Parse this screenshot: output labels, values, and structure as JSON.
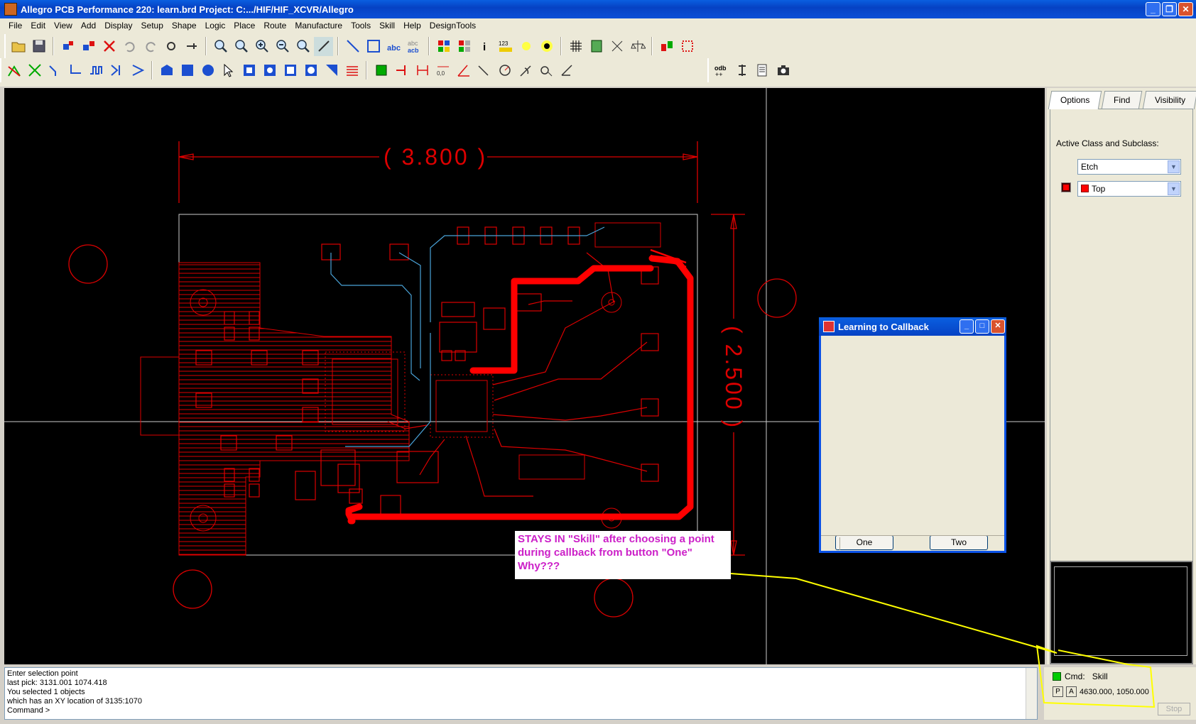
{
  "window": {
    "title": "Allegro PCB Performance 220: learn.brd  Project: C:.../HIF/HIF_XCVR/Allegro",
    "minimize": "_",
    "restore": "❐",
    "close": "✕"
  },
  "menu": [
    "File",
    "Edit",
    "View",
    "Add",
    "Display",
    "Setup",
    "Shape",
    "Logic",
    "Place",
    "Route",
    "Manufacture",
    "Tools",
    "Skill",
    "Help",
    "DesignTools"
  ],
  "canvas": {
    "dim_width": "( 3.800 )",
    "dim_height": "( 2.500 )",
    "annotation": [
      "STAYS IN \"Skill\" after choosing a point",
      "during callback from button \"One\"",
      "Why???"
    ]
  },
  "dialog": {
    "title": "Learning to Callback",
    "button_one": "One",
    "button_two": "Two"
  },
  "panel": {
    "tabs": [
      "Options",
      "Find",
      "Visibility"
    ],
    "active_label": "Active Class and Subclass:",
    "class_value": "Etch",
    "subclass_value": "Top"
  },
  "console": {
    "lines": [
      "Enter selection point",
      "last pick:  3131.001  1074.418",
      "You selected 1 objects",
      "which has an XY location of 3135:1070",
      "Command >"
    ]
  },
  "status": {
    "cmd_label": "Cmd:",
    "cmd_value": "Skill",
    "p_label": "P",
    "a_label": "A",
    "coords": "4630.000, 1050.000",
    "stop": "Stop"
  },
  "colors": {
    "board": "#ff0000",
    "trace_blue": "#4aa3d8",
    "highlight_yellow": "#ffff00",
    "annotation_text": "#cc20c8",
    "cmd_indicator": "#00cc00"
  }
}
